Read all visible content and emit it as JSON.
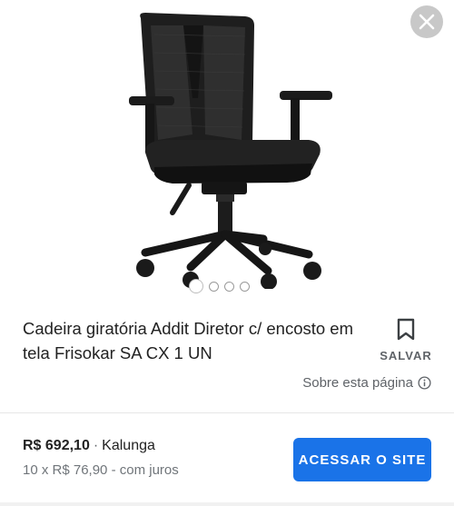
{
  "product": {
    "title": "Cadeira giratória Addit Diretor c/ encosto em tela Frisokar SA CX 1 UN",
    "image_icon": "office-chair",
    "carousel": {
      "count": 4,
      "active_index": 0
    }
  },
  "actions": {
    "save_label": "SALVAR",
    "save_icon": "bookmark-icon",
    "close_icon": "close-icon",
    "about_label": "Sobre esta página",
    "about_icon": "info-icon"
  },
  "offer": {
    "price": "R$ 692,10",
    "separator": "·",
    "seller": "Kalunga",
    "installments": "10 x R$ 76,90 - com juros",
    "cta_label": "ACESSAR O SITE"
  },
  "colors": {
    "accent": "#1a73e8",
    "text_primary": "#222222",
    "text_secondary": "#5f6368",
    "close_bg": "#c8c8c8"
  }
}
